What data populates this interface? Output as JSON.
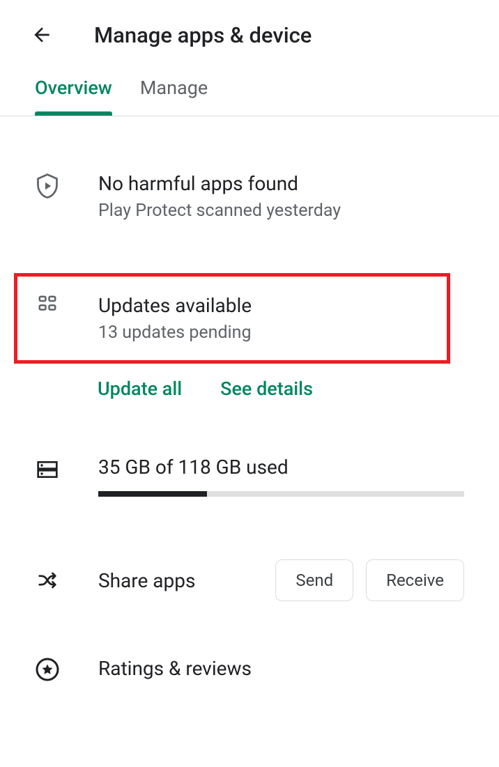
{
  "header": {
    "title": "Manage apps & device"
  },
  "tabs": {
    "overview": "Overview",
    "manage": "Manage"
  },
  "protect": {
    "title": "No harmful apps found",
    "subtitle": "Play Protect scanned yesterday"
  },
  "updates": {
    "title": "Updates available",
    "subtitle": "13 updates pending",
    "update_all": "Update all",
    "see_details": "See details"
  },
  "storage": {
    "label": "35 GB of 118 GB used",
    "used_gb": 35,
    "total_gb": 118
  },
  "share": {
    "label": "Share apps",
    "send": "Send",
    "receive": "Receive"
  },
  "ratings": {
    "label": "Ratings & reviews"
  }
}
